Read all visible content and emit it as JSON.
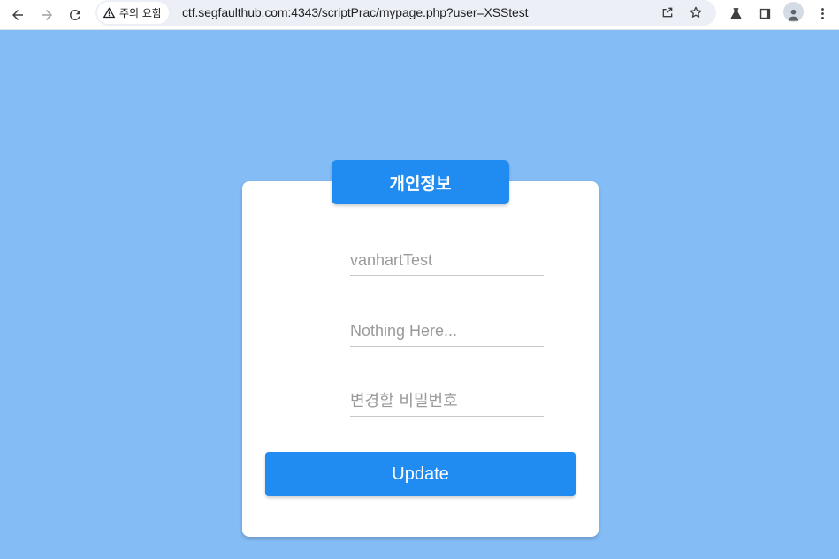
{
  "browser": {
    "security_label": "주의 요함",
    "url": "ctf.segfaulthub.com:4343/scriptPrac/mypage.php?user=XSStest"
  },
  "card": {
    "title": "개인정보",
    "fields": [
      {
        "name": "username",
        "placeholder": "vanhartTest"
      },
      {
        "name": "info",
        "placeholder": "Nothing Here..."
      },
      {
        "name": "new_password",
        "placeholder": "변경할 비밀번호"
      }
    ],
    "submit_label": "Update"
  },
  "colors": {
    "background": "#84bcf5",
    "accent": "#208bf0",
    "card": "#ffffff"
  }
}
